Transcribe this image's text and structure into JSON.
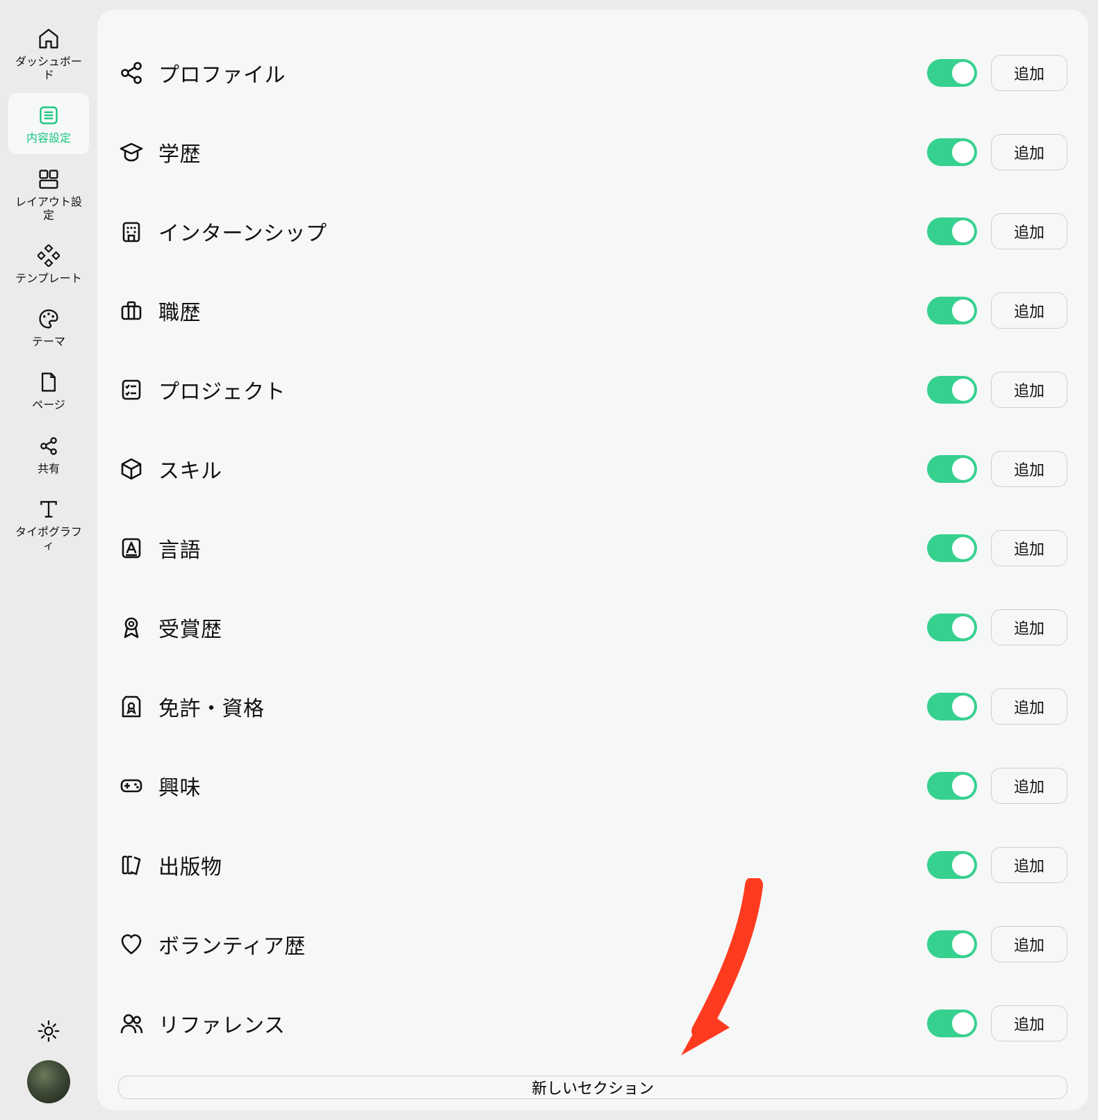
{
  "sidebar": {
    "items": [
      {
        "id": "dashboard",
        "label": "ダッシュボード",
        "icon": "home-icon"
      },
      {
        "id": "content",
        "label": "内容設定",
        "icon": "list-icon",
        "active": true
      },
      {
        "id": "layout",
        "label": "レイアウト設定",
        "icon": "layout-icon"
      },
      {
        "id": "template",
        "label": "テンプレート",
        "icon": "diamond-grid-icon"
      },
      {
        "id": "theme",
        "label": "テーマ",
        "icon": "palette-icon"
      },
      {
        "id": "page",
        "label": "ページ",
        "icon": "file-icon"
      },
      {
        "id": "share",
        "label": "共有",
        "icon": "share-icon"
      },
      {
        "id": "typography",
        "label": "タイポグラフィ",
        "icon": "typography-icon"
      }
    ]
  },
  "sections": [
    {
      "id": "profile",
      "label": "プロファイル",
      "icon": "share-nodes-icon",
      "enabled": true,
      "add_label": "追加"
    },
    {
      "id": "education",
      "label": "学歴",
      "icon": "graduation-cap-icon",
      "enabled": true,
      "add_label": "追加"
    },
    {
      "id": "internship",
      "label": "インターンシップ",
      "icon": "building-icon",
      "enabled": true,
      "add_label": "追加"
    },
    {
      "id": "work",
      "label": "職歴",
      "icon": "briefcase-icon",
      "enabled": true,
      "add_label": "追加"
    },
    {
      "id": "project",
      "label": "プロジェクト",
      "icon": "checklist-icon",
      "enabled": true,
      "add_label": "追加"
    },
    {
      "id": "skill",
      "label": "スキル",
      "icon": "cube-icon",
      "enabled": true,
      "add_label": "追加"
    },
    {
      "id": "language",
      "label": "言語",
      "icon": "language-icon",
      "enabled": true,
      "add_label": "追加"
    },
    {
      "id": "award",
      "label": "受賞歴",
      "icon": "medal-icon",
      "enabled": true,
      "add_label": "追加"
    },
    {
      "id": "certification",
      "label": "免許・資格",
      "icon": "certificate-icon",
      "enabled": true,
      "add_label": "追加"
    },
    {
      "id": "interest",
      "label": "興味",
      "icon": "controller-icon",
      "enabled": true,
      "add_label": "追加"
    },
    {
      "id": "publication",
      "label": "出版物",
      "icon": "books-icon",
      "enabled": true,
      "add_label": "追加"
    },
    {
      "id": "volunteer",
      "label": "ボランティア歴",
      "icon": "heart-icon",
      "enabled": true,
      "add_label": "追加"
    },
    {
      "id": "reference",
      "label": "リファレンス",
      "icon": "users-icon",
      "enabled": true,
      "add_label": "追加"
    }
  ],
  "new_section_label": "新しいセクション",
  "colors": {
    "accent": "#15c57f",
    "toggle_on": "#37d18f",
    "panel_bg": "#f6f7f7",
    "app_bg": "#ebebeb",
    "arrow": "#ff3b1f"
  }
}
